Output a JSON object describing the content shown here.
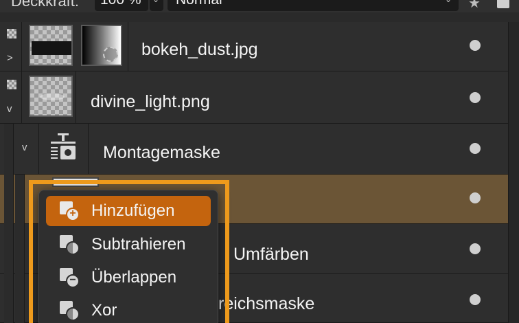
{
  "toolbar": {
    "opacity_label": "Deckkraft:",
    "opacity_value": "100 %",
    "blend_mode": "Normal"
  },
  "layers": [
    {
      "name": "bokeh_dust.jpg"
    },
    {
      "name": "divine_light.png"
    },
    {
      "name": "Montagemaske"
    },
    {
      "name": ""
    },
    {
      "name": "Umfärben"
    },
    {
      "name": "reichsmaske"
    }
  ],
  "popup_menu": {
    "items": [
      {
        "label": "Hinzufügen",
        "icon": "add-mask-icon",
        "active": true
      },
      {
        "label": "Subtrahieren",
        "icon": "subtract-mask-icon",
        "active": false
      },
      {
        "label": "Überlappen",
        "icon": "intersect-mask-icon",
        "active": false
      },
      {
        "label": "Xor",
        "icon": "xor-mask-icon",
        "active": false
      }
    ]
  },
  "colors": {
    "accent_orange": "#ee9a1c",
    "menu_active": "#c4640e",
    "selected_row": "#6b5536"
  },
  "icons": {
    "disclosure_closed": ">",
    "disclosure_open": "v",
    "chevron": "⌄",
    "star": "★"
  }
}
